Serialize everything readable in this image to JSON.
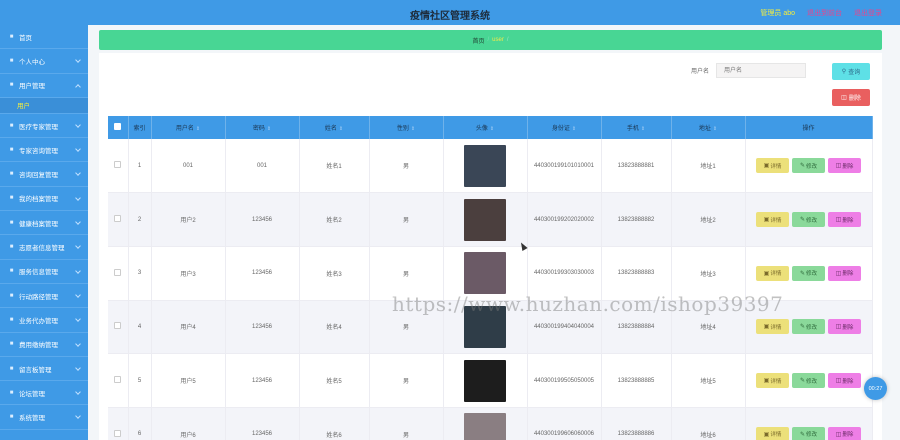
{
  "header": {
    "title": "疫情社区管理系统",
    "admin_label": "管理员 abo",
    "link_home": "退出到前台",
    "link_logout": "退出登录"
  },
  "sidebar": {
    "items": [
      {
        "label": "首页",
        "icon": "home-icon"
      },
      {
        "label": "个人中心",
        "icon": "user-icon"
      },
      {
        "label": "用户管理",
        "icon": "users-icon",
        "open": true,
        "sub": [
          "用户"
        ]
      },
      {
        "label": "医疗专家管理",
        "icon": "doctor-icon"
      },
      {
        "label": "专家咨询管理",
        "icon": "chat-icon"
      },
      {
        "label": "咨询回复管理",
        "icon": "reply-icon"
      },
      {
        "label": "我的档案管理",
        "icon": "file-icon"
      },
      {
        "label": "健康档案管理",
        "icon": "heart-icon"
      },
      {
        "label": "志愿者信息管理",
        "icon": "volunteer-icon"
      },
      {
        "label": "服务信息管理",
        "icon": "service-icon"
      },
      {
        "label": "行动路径管理",
        "icon": "route-icon"
      },
      {
        "label": "业务代办管理",
        "icon": "task-icon"
      },
      {
        "label": "费用缴纳管理",
        "icon": "money-icon"
      },
      {
        "label": "留言板管理",
        "icon": "message-icon"
      },
      {
        "label": "论坛管理",
        "icon": "forum-icon"
      },
      {
        "label": "系统管理",
        "icon": "settings-icon"
      }
    ]
  },
  "breadcrumb": {
    "home": "首页",
    "sep": "/",
    "current": "user",
    "tail": "/"
  },
  "search": {
    "label": "用户名",
    "placeholder": "用户名",
    "button": "查询",
    "delete_button": "删除"
  },
  "table": {
    "headers": [
      "索引",
      "用户名",
      "密码",
      "姓名",
      "性别",
      "头像",
      "身份证",
      "手机",
      "地址",
      "操作"
    ],
    "sortable": [
      false,
      true,
      true,
      true,
      true,
      true,
      true,
      true,
      true,
      false
    ],
    "rows": [
      {
        "index": "1",
        "username": "001",
        "password": "001",
        "name": "姓名1",
        "gender": "男",
        "avatar_color": "#3a4656",
        "idcard": "440300199101010001",
        "phone": "13823888881",
        "address": "地址1"
      },
      {
        "index": "2",
        "username": "用户2",
        "password": "123456",
        "name": "姓名2",
        "gender": "男",
        "avatar_color": "#4b3f3e",
        "idcard": "440300199202020002",
        "phone": "13823888882",
        "address": "地址2"
      },
      {
        "index": "3",
        "username": "用户3",
        "password": "123456",
        "name": "姓名3",
        "gender": "男",
        "avatar_color": "#6b5a66",
        "idcard": "440300199303030003",
        "phone": "13823888883",
        "address": "地址3"
      },
      {
        "index": "4",
        "username": "用户4",
        "password": "123456",
        "name": "姓名4",
        "gender": "男",
        "avatar_color": "#2f3d48",
        "idcard": "440300199404040004",
        "phone": "13823888884",
        "address": "地址4"
      },
      {
        "index": "5",
        "username": "用户5",
        "password": "123456",
        "name": "姓名5",
        "gender": "男",
        "avatar_color": "#1d1d1d",
        "idcard": "440300199505050005",
        "phone": "13823888885",
        "address": "地址5"
      },
      {
        "index": "6",
        "username": "用户6",
        "password": "123456",
        "name": "姓名6",
        "gender": "男",
        "avatar_color": "#8a7e82",
        "idcard": "440300199606060006",
        "phone": "13823888886",
        "address": "地址6"
      }
    ],
    "actions": {
      "detail": "详情",
      "edit": "修改",
      "delete": "删除"
    }
  },
  "watermark": "https://www.huzhan.com/ishop39397",
  "timer": "00:27",
  "colors": {
    "primary": "#3f9ae6",
    "breadcrumb": "#48d694",
    "search_btn": "#5ee0e6",
    "delete_btn": "#e95f5f"
  }
}
